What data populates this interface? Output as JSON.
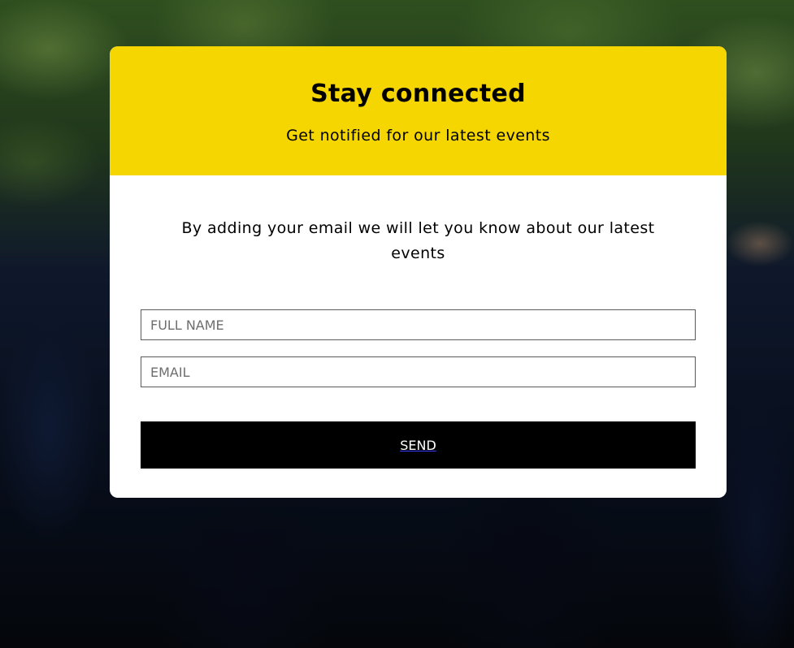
{
  "newsletter": {
    "title": "Stay connected",
    "subtitle": "Get notified for our latest events",
    "intro": "By adding your email we will let you know about our latest events",
    "name_placeholder": "FULL NAME",
    "email_placeholder": "EMAIL",
    "send_label": "SEND"
  },
  "colors": {
    "header_bg": "#f5d600",
    "button_bg": "#000000",
    "card_bg": "#ffffff"
  }
}
